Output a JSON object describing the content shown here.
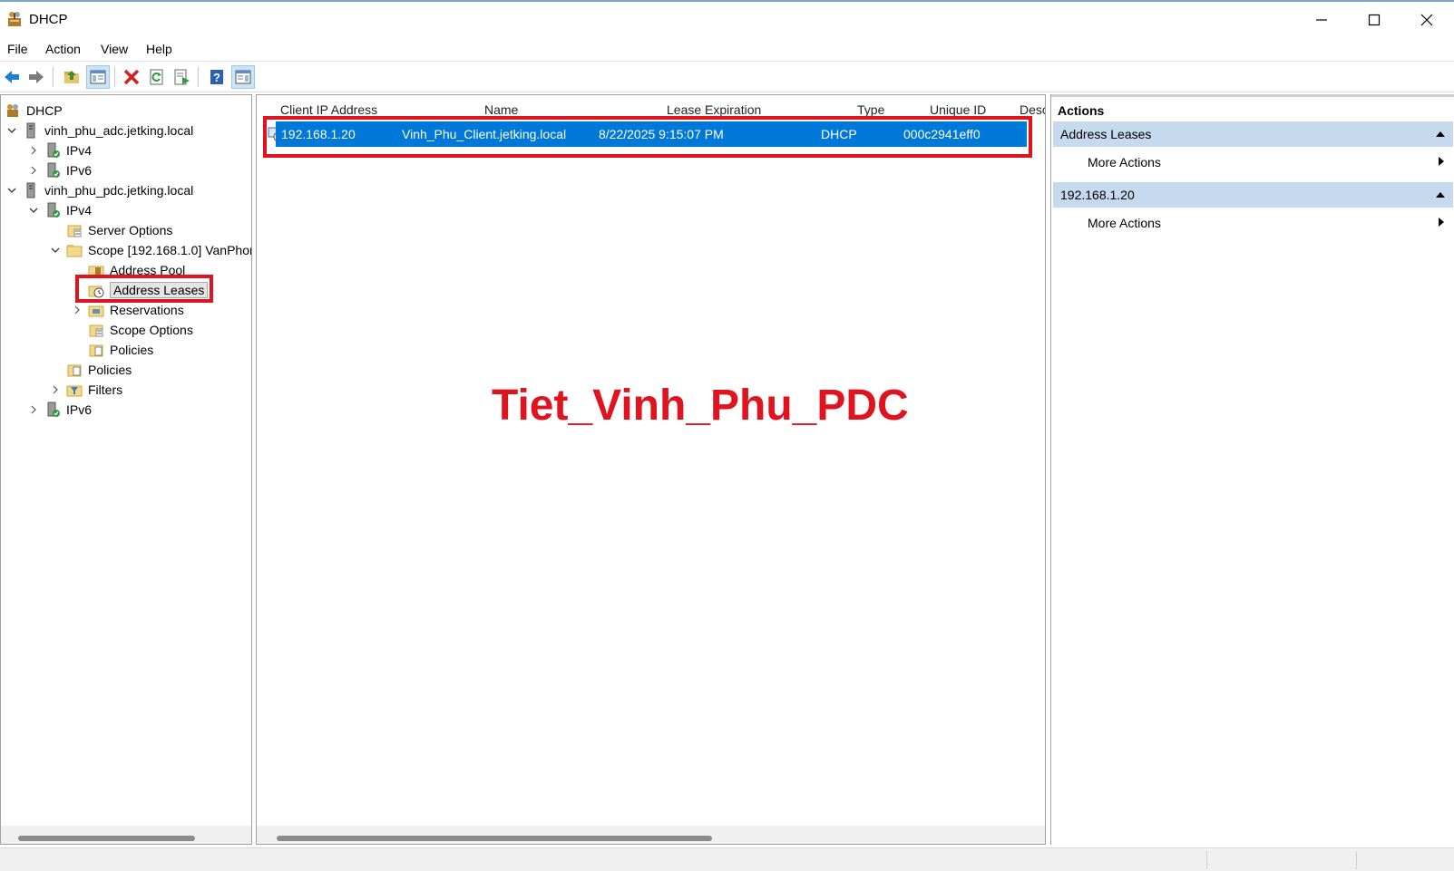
{
  "window": {
    "title": "DHCP",
    "controls": [
      "minimize-icon",
      "maximize-icon",
      "close-icon"
    ]
  },
  "menu": [
    "File",
    "Action",
    "View",
    "Help"
  ],
  "toolbar": {
    "buttons": [
      "back-arrow-icon",
      "forward-arrow-icon",
      "up-folder-icon",
      "show-hide-tree-icon",
      "delete-icon",
      "refresh-icon",
      "export-list-icon",
      "help-icon",
      "show-hide-action-pane-icon"
    ]
  },
  "tree": {
    "root": "DHCP",
    "server1": "vinh_phu_adc.jetking.local",
    "server1_ipv4": "IPv4",
    "server1_ipv6": "IPv6",
    "server2": "vinh_phu_pdc.jetking.local",
    "server2_ipv4": "IPv4",
    "server_options": "Server Options",
    "scope": "Scope [192.168.1.0] VanPhor",
    "address_pool": "Address Pool",
    "address_leases": "Address Leases",
    "reservations": "Reservations",
    "scope_options": "Scope Options",
    "scope_policies": "Policies",
    "policies": "Policies",
    "filters": "Filters",
    "server2_ipv6": "IPv6"
  },
  "list": {
    "columns": {
      "ip": "Client IP Address",
      "name": "Name",
      "expiration": "Lease Expiration",
      "type": "Type",
      "uid": "Unique ID",
      "desc": "Desc"
    },
    "rows": [
      {
        "ip": "192.168.1.20",
        "name": "Vinh_Phu_Client.jetking.local",
        "expiration": "8/22/2025 9:15:07 PM",
        "type": "DHCP",
        "uid": "000c2941eff0"
      }
    ]
  },
  "watermark": "Tiet_Vinh_Phu_PDC",
  "actions": {
    "title": "Actions",
    "section1": "Address Leases",
    "section1_item": "More Actions",
    "section2": "192.168.1.20",
    "section2_item": "More Actions"
  },
  "colors": {
    "selection": "#0078d7",
    "highlight_box": "#e0141e",
    "action_header": "#c6d9ee"
  }
}
